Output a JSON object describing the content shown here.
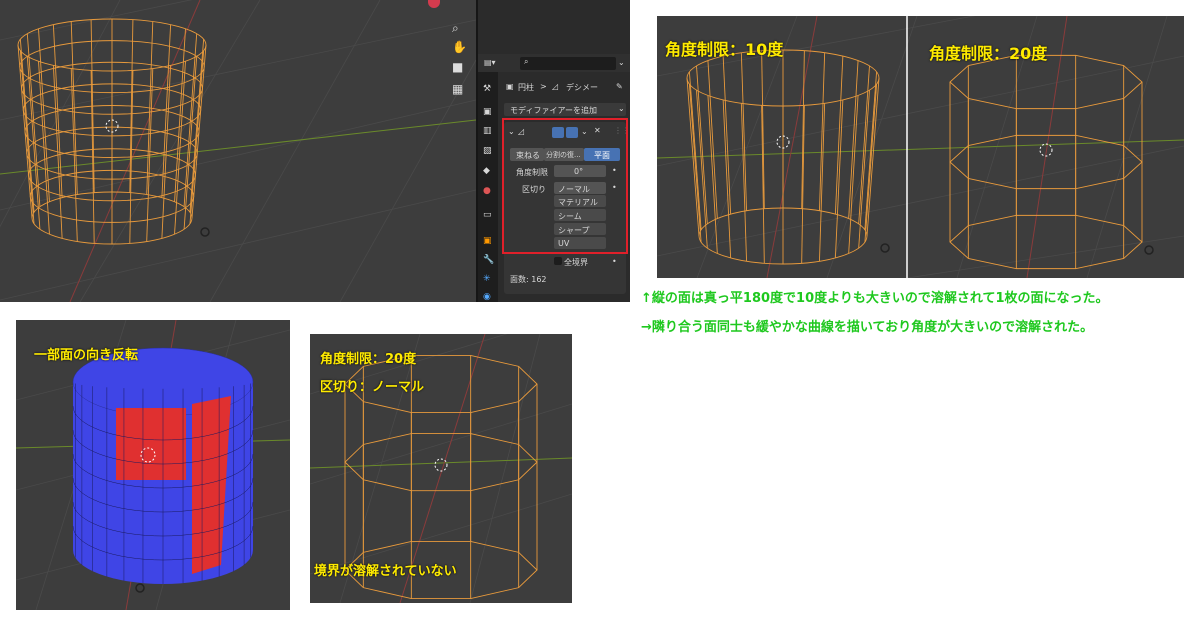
{
  "labels": {
    "angle10": "角度制限：10度",
    "angle20": "角度制限：20度",
    "flip_note": "一部面の向き反転",
    "bottom_angle": "角度制限：20度",
    "bottom_delimit": "区切り：ノーマル",
    "boundary_note": "境界が溶解されていない"
  },
  "notes": {
    "line1": "↑縦の面は真っ平180度で10度よりも大きいので溶解されて1枚の面になった。",
    "line2": "→隣り合う面同士も緩やかな曲線を描いており角度が大きいので溶解された。"
  },
  "blender": {
    "breadcrumb_object": "円柱",
    "breadcrumb_modifier": "デシメー",
    "add_modifier": "モディファイアーを追加",
    "tabs": [
      "束ねる",
      "分割の復...",
      "平面"
    ],
    "active_tab": "平面",
    "angle_limit_label": "角度制限",
    "angle_limit_value": "0°",
    "delimit_label": "区切り",
    "delimit_options": [
      "ノーマル",
      "マテリアル",
      "シーム",
      "シャープ",
      "UV"
    ],
    "all_boundaries": "全境界",
    "face_count": "面数: 162"
  },
  "colors": {
    "viewport_bg": "#3d3d3d",
    "wire": "#e89a3c",
    "label_yellow": "#ffeb00",
    "note_green": "#1ec81e",
    "highlight_red": "#e0202a",
    "face_blue": "#3f45e6",
    "face_red": "#e03030",
    "active_tab_blue": "#4772b3"
  }
}
